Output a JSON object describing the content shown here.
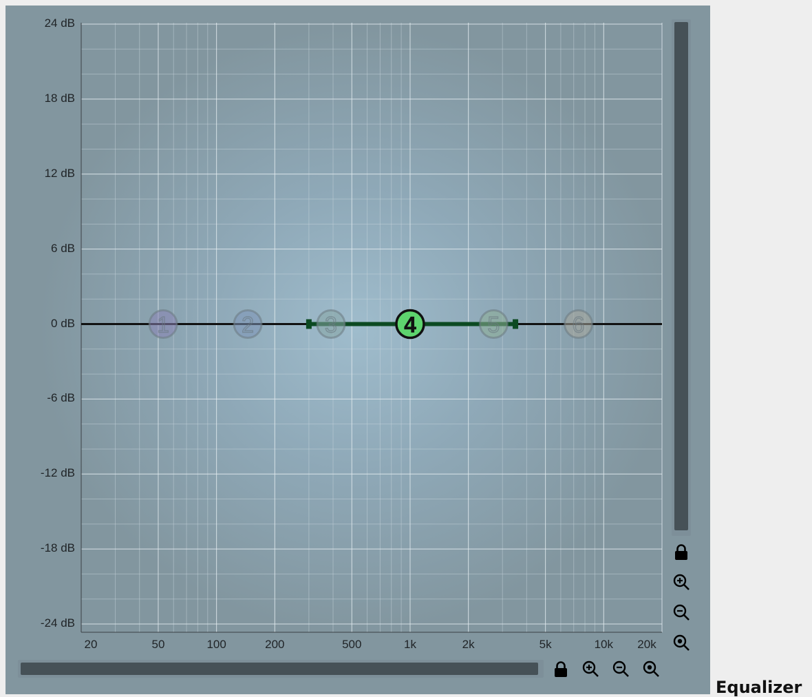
{
  "section_title": "Equalizer",
  "graph": {
    "y_axis": {
      "unit": "dB",
      "range": [
        -24,
        24
      ],
      "major_ticks": [
        "24 dB",
        "18 dB",
        "12 dB",
        "6 dB",
        "0 dB",
        "-6 dB",
        "-12 dB",
        "-18 dB",
        "-24 dB"
      ],
      "major_values": [
        24,
        18,
        12,
        6,
        0,
        -6,
        -12,
        -18,
        -24
      ]
    },
    "x_axis": {
      "scale": "log",
      "range_hz": [
        20,
        20000
      ],
      "tick_labels": [
        "20",
        "50",
        "100",
        "200",
        "500",
        "1k",
        "2k",
        "5k",
        "10k",
        "20k"
      ],
      "tick_values_hz": [
        20,
        50,
        100,
        200,
        500,
        1000,
        2000,
        5000,
        10000,
        20000
      ]
    },
    "response_curve_gain_db": 0,
    "bands": [
      {
        "id": "1",
        "freq_hz": 53,
        "gain_db": 0,
        "active": false,
        "color": "#8a83b5"
      },
      {
        "id": "2",
        "freq_hz": 145,
        "gain_db": 0,
        "active": false,
        "color": "#7d95b8"
      },
      {
        "id": "3",
        "freq_hz": 390,
        "gain_db": 0,
        "active": false,
        "color": "#86a6a4"
      },
      {
        "id": "4",
        "freq_hz": 1000,
        "gain_db": 0,
        "active": true,
        "color": "#5ed46e"
      },
      {
        "id": "5",
        "freq_hz": 2700,
        "gain_db": 0,
        "active": false,
        "color": "#8eaf96"
      },
      {
        "id": "6",
        "freq_hz": 7400,
        "gain_db": 0,
        "active": false,
        "color": "#a5a59a"
      }
    ],
    "selected_band_range_hz": [
      300,
      3500
    ],
    "colors": {
      "curve": "#111111",
      "selected_range": "#0c4a22",
      "active_node": "#5ed46e"
    }
  },
  "controls": {
    "vertical": [
      "lock-icon",
      "zoom-in-icon",
      "zoom-out-icon",
      "zoom-reset-icon"
    ],
    "horizontal": [
      "lock-icon",
      "zoom-in-icon",
      "zoom-out-icon",
      "zoom-reset-icon"
    ]
  }
}
